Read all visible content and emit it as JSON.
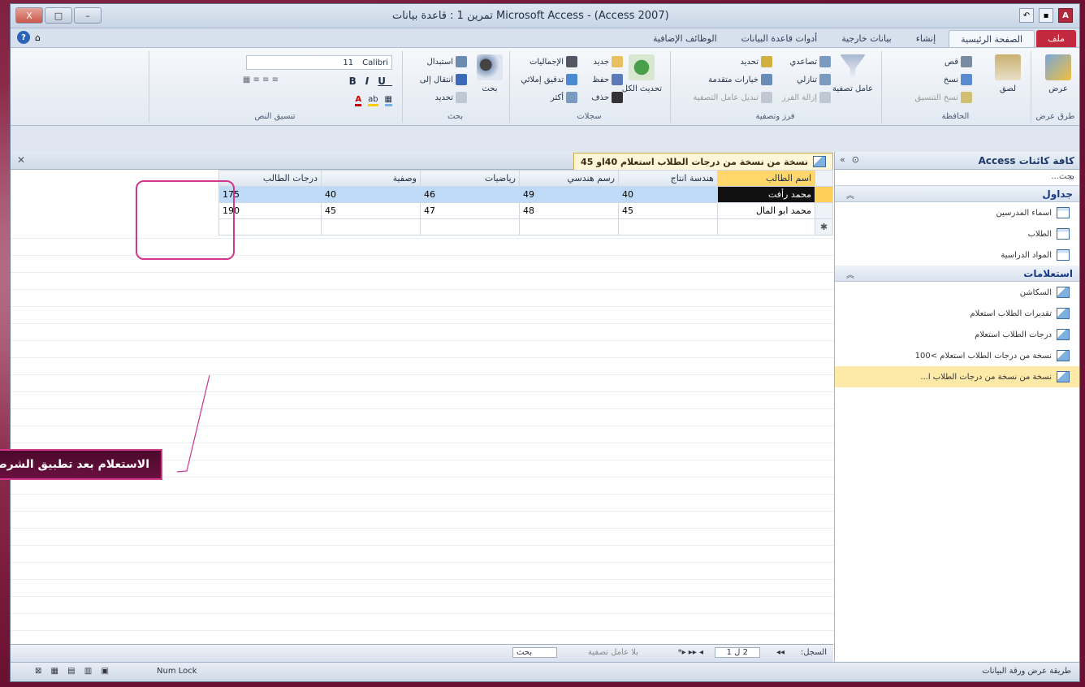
{
  "window": {
    "title": "Microsoft Access - (Access 2007) تمرين 1 : قاعدة بيانات",
    "controls": [
      "X",
      "□",
      "–"
    ]
  },
  "tabs": [
    "ملف",
    "الصفحة الرئيسية",
    "إنشاء",
    "بيانات خارجية",
    "أدوات قاعدة البيانات",
    "الوظائف الإضافية"
  ],
  "ribbon": {
    "views": {
      "label": "طرق عرض",
      "btn": "عرض"
    },
    "clipboard": {
      "label": "الحافظة",
      "paste": "لصق",
      "cut": "قص",
      "copy": "نسخ",
      "format": "نسخ التنسيق"
    },
    "sort": {
      "label": "فرز وتصفية",
      "filter": "عامل تصفية",
      "asc": "تصاعدي",
      "desc": "تنازلي",
      "remove": "إزالة الفرز",
      "select": "تحديد",
      "advanced": "خيارات متقدمة",
      "toggle": "تبديل عامل التصفية"
    },
    "records": {
      "label": "سجلات",
      "refresh": "تحديث الكل",
      "new": "جديد",
      "save": "حفظ",
      "delete": "حذف",
      "totals": "الإجماليات",
      "spell": "تدقيق إملائي",
      "more": "أكثر"
    },
    "find": {
      "label": "بحث",
      "find": "بحث",
      "replace": "استبدال",
      "goto": "انتقال إلى",
      "select": "تحديد"
    },
    "text": {
      "label": "تنسيق النص",
      "font": "Calibri",
      "size": "11"
    }
  },
  "nav": {
    "title": "كافة كائنات Access",
    "search": "بحث...",
    "tables_label": "جداول",
    "tables": [
      "اسماء المدرسين",
      "الطلاب",
      "المواد الدراسية"
    ],
    "queries_label": "استعلامات",
    "queries": [
      "السكاشن",
      "تقديرات الطلاب استعلام",
      "درجات الطلاب استعلام",
      "نسخة من درجات الطلاب استعلام >100",
      "نسخة من نسخة من درجات الطلاب ا..."
    ]
  },
  "doc": {
    "tab_title": "نسخة من نسخة من درجات الطلاب استعلام 40او 45",
    "columns": [
      "اسم الطالب",
      "هندسة انتاج",
      "رسم هندسي",
      "رياضيات",
      "وصفية",
      "درجات الطالب"
    ],
    "rows": [
      [
        "محمد رأفت",
        "40",
        "49",
        "46",
        "40",
        "175"
      ],
      [
        "محمد ابو المال",
        "45",
        "48",
        "47",
        "45",
        "190"
      ]
    ]
  },
  "recnav": {
    "label": "السجل:",
    "position": "2 ل 1",
    "nofilter": "بلا عامل تصفية",
    "search": "بحث"
  },
  "status": {
    "left": "طريقة عرض ورقة البيانات",
    "numlock": "Num Lock"
  },
  "callout": "الاستعلام بعد تطبيق الشرط"
}
